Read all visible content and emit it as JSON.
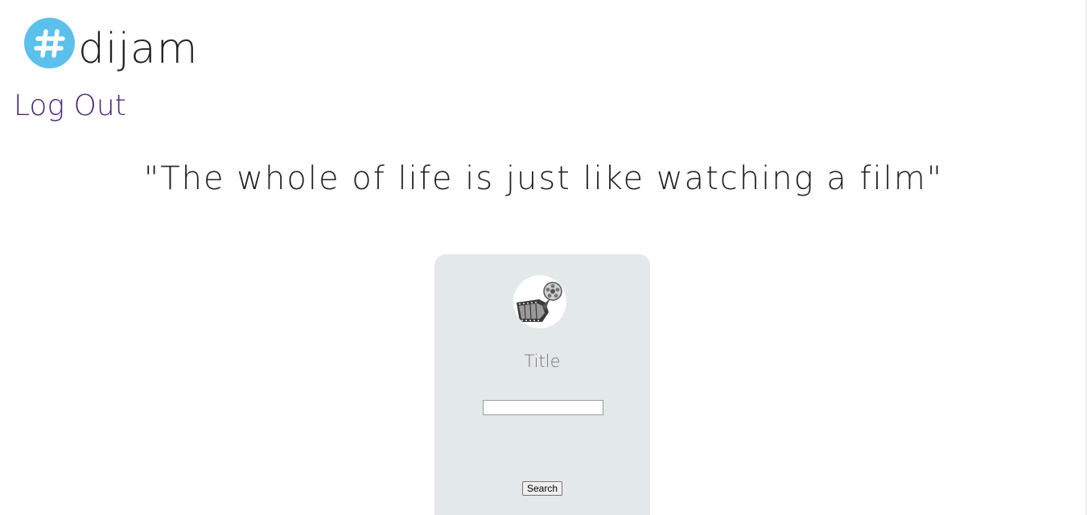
{
  "header": {
    "logo_text": "dijam",
    "logo_icon": "hashtag-icon",
    "brand_color": "#5bc0eb",
    "logout_label": "Log Out"
  },
  "hero": {
    "quote": "\"The whole of life is just like watching a film\""
  },
  "search_card": {
    "avatar_icon": "film-reel-icon",
    "title_label": "Title",
    "title_input_value": "",
    "search_button_label": "Search"
  }
}
